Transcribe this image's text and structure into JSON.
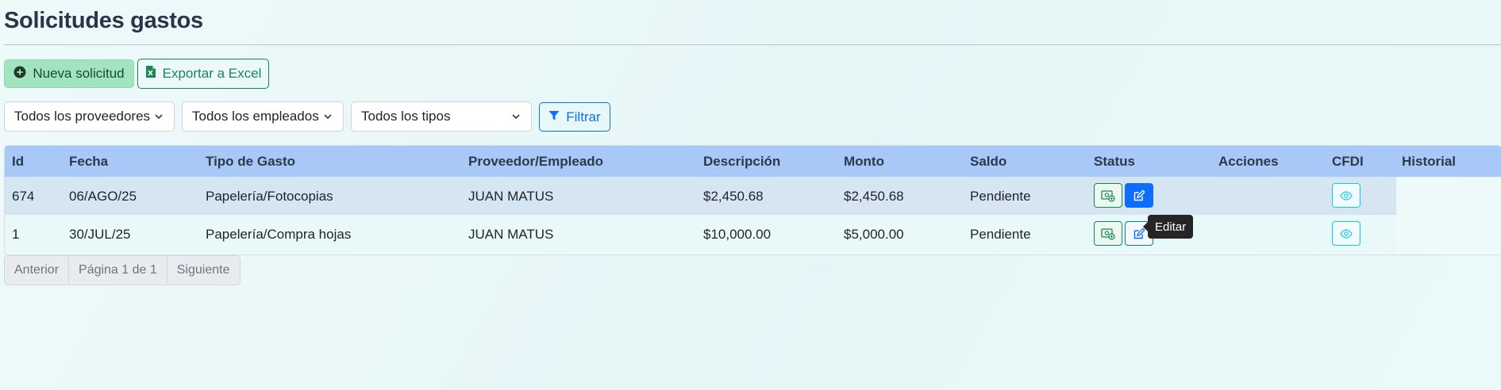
{
  "page": {
    "title": "Solicitudes gastos"
  },
  "toolbar": {
    "new_label": "Nueva solicitud",
    "excel_label": "Exportar a Excel"
  },
  "filters": {
    "providers": "Todos los proveedores",
    "employees": "Todos los empleados",
    "types": "Todos los tipos",
    "filter_label": "Filtrar"
  },
  "table": {
    "headers": [
      "Id",
      "Fecha",
      "Tipo de Gasto",
      "Proveedor/Empleado",
      "Descripción",
      "Monto",
      "Saldo",
      "Status",
      "Acciones",
      "CFDI",
      "Historial"
    ],
    "rows": [
      {
        "id": "674",
        "fecha": "06/AGO/25",
        "tipo": "Papelería/Fotocopias",
        "proveedor": "JUAN MATUS",
        "descripcion": "$2,450.68",
        "monto": "$2,450.68",
        "saldo": "Pendiente"
      },
      {
        "id": "1",
        "fecha": "30/JUL/25",
        "tipo": "Papelería/Compra hojas",
        "proveedor": "JUAN MATUS",
        "descripcion": "$10,000.00",
        "monto": "$5,000.00",
        "saldo": "Pendiente"
      }
    ]
  },
  "tooltip": {
    "text": "Editar"
  },
  "pagination": {
    "prev": "Anterior",
    "page": "Página 1 de 1",
    "next": "Siguiente"
  },
  "colors": {
    "primary": "#0d6efd",
    "success": "#198754",
    "info": "#0dcaf0",
    "header_bg": "#a8c8f7"
  },
  "icons": [
    "plus-circle-icon",
    "excel-file-icon",
    "chevron-down-icon",
    "funnel-icon",
    "money-icon",
    "edit-icon",
    "eye-icon"
  ]
}
